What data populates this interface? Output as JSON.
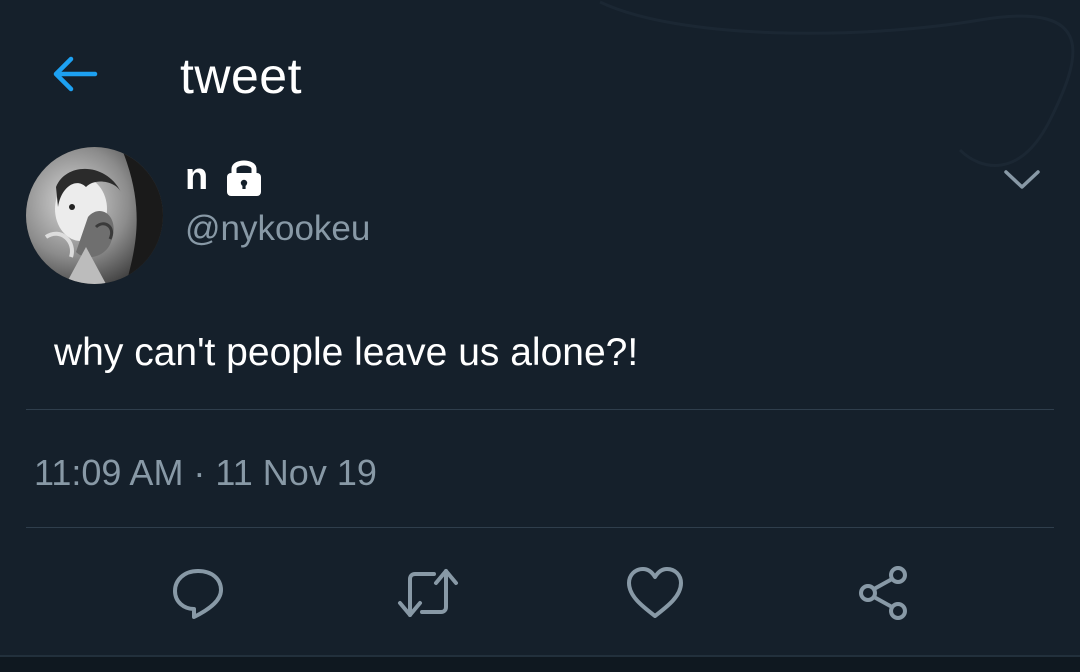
{
  "header": {
    "title": "tweet",
    "back_icon": "arrow-left-icon"
  },
  "author": {
    "display_name": "n",
    "username": "@nykookeu",
    "protected_icon": "lock-icon",
    "avatar_icon": "avatar-photo"
  },
  "tweet": {
    "text": "why can't people leave us alone?!",
    "timestamp": "11:09 AM · 11 Nov 19",
    "menu_icon": "chevron-down-icon"
  },
  "actions": [
    {
      "name": "reply",
      "icon": "reply-icon"
    },
    {
      "name": "retweet",
      "icon": "retweet-icon"
    },
    {
      "name": "like",
      "icon": "heart-icon"
    },
    {
      "name": "share",
      "icon": "share-icon"
    }
  ],
  "colors": {
    "background": "#15202b",
    "accent": "#1da1f2",
    "secondary_text": "#8899a6",
    "divider": "#2f3e4c"
  }
}
